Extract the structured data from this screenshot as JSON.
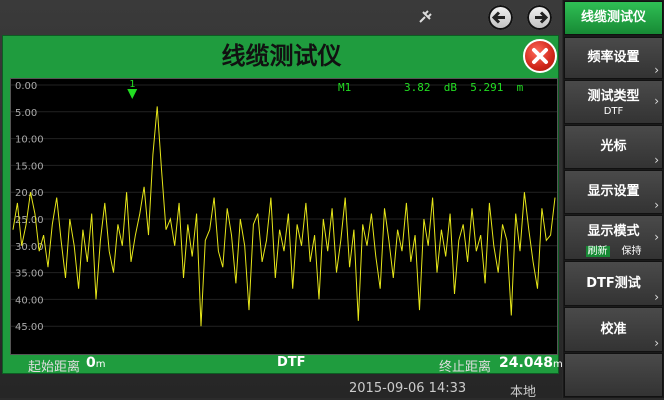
{
  "topbar": {
    "plug_icon": "plug-icon",
    "back_icon": "arrow-left-icon",
    "forward_icon": "arrow-right-icon"
  },
  "window": {
    "title": "线缆测试仪",
    "close_icon": "close-icon"
  },
  "plot": {
    "marker_label": "M1",
    "marker_readout": "3.82  dB  5.291  m",
    "marker_number": "1",
    "y_ticks": [
      "0.00",
      "5.00",
      "10.00",
      "15.00",
      "20.00",
      "25.00",
      "30.00",
      "35.00",
      "40.00",
      "45.00"
    ],
    "trace_color": "#e6e619",
    "marker_color": "#22dd22"
  },
  "footer": {
    "start_label": "起始距离",
    "start_value": "0",
    "start_unit": "m",
    "mode": "DTF",
    "stop_label": "终止距离",
    "stop_value": "24.048",
    "stop_unit": "m"
  },
  "status": {
    "datetime": "2015-09-06 14:33",
    "location": "本地"
  },
  "sidebar": {
    "title": "线缆测试仪",
    "items": [
      {
        "label": "频率设置",
        "sub": ""
      },
      {
        "label": "测试类型",
        "sub": "DTF"
      },
      {
        "label": "光标",
        "sub": ""
      },
      {
        "label": "显示设置",
        "sub": ""
      },
      {
        "label": "显示模式",
        "opt1": "刷新",
        "opt2": "保持"
      },
      {
        "label": "DTF测试",
        "sub": ""
      },
      {
        "label": "校准",
        "sub": ""
      }
    ]
  },
  "chart_data": {
    "type": "line",
    "ylim": [
      0,
      50
    ],
    "y_reversed": true,
    "xlim": [
      0,
      24.048
    ],
    "x_unit": "m",
    "y_unit": "dB",
    "marker": {
      "name": "M1",
      "x": 5.291,
      "y": 3.82
    },
    "values": [
      27,
      22,
      30,
      26,
      20,
      24,
      31,
      28,
      34,
      26,
      21,
      29,
      36,
      25,
      30,
      38,
      27,
      33,
      24,
      40,
      29,
      22,
      31,
      35,
      26,
      30,
      20,
      33,
      28,
      24,
      19,
      28,
      13,
      4,
      16,
      27,
      25,
      30,
      22,
      36,
      26,
      32,
      24,
      45,
      29,
      27,
      21,
      31,
      34,
      23,
      28,
      37,
      25,
      30,
      42,
      26,
      24,
      33,
      29,
      21,
      36,
      27,
      31,
      24,
      38,
      26,
      30,
      22,
      33,
      28,
      40,
      25,
      31,
      23,
      35,
      29,
      21,
      34,
      27,
      44,
      26,
      30,
      24,
      32,
      38,
      23,
      29,
      36,
      27,
      31,
      22,
      33,
      28,
      42,
      25,
      30,
      21,
      35,
      27,
      32,
      24,
      39,
      29,
      26,
      33,
      23,
      31,
      28,
      37,
      22,
      30,
      35,
      26,
      29,
      43,
      24,
      31,
      20,
      27,
      33,
      38,
      23,
      29,
      28,
      21
    ]
  }
}
